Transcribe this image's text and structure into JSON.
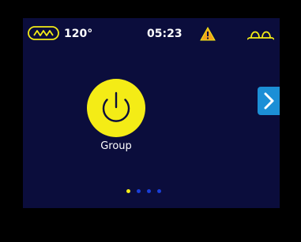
{
  "status_bar": {
    "heater_icon": "heater-coil-icon",
    "temperature": "120°",
    "time": "05:23",
    "warning_icon": "warning-triangle-icon",
    "light_icon": "light-lamp-icon"
  },
  "main": {
    "power_icon": "power-icon",
    "group_label": "Group",
    "next_icon": "chevron-right-icon"
  },
  "pager": {
    "total_pages": 4,
    "active_index": 0
  },
  "colors": {
    "screen_bg": "#0b0d3c",
    "accent_yellow": "#f4ec16",
    "nav_blue": "#1c8fd6",
    "dot_blue": "#1a3fd8",
    "warning_orange": "#f2a51c"
  }
}
